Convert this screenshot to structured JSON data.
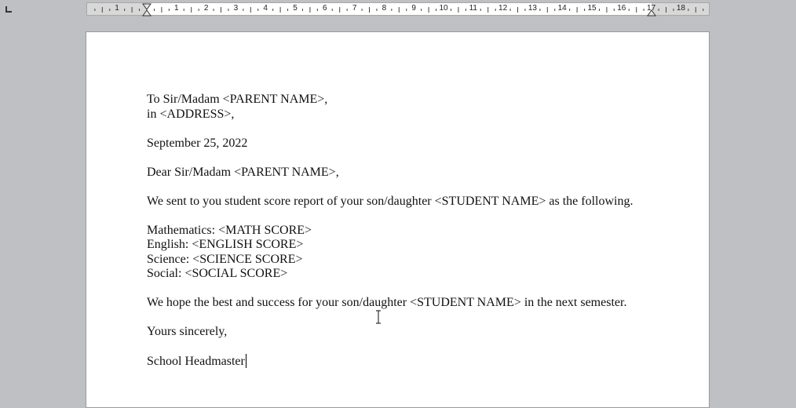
{
  "ruler": {
    "left_labels": [
      "1"
    ],
    "labels": [
      "1",
      "2",
      "3",
      "4",
      "5",
      "6",
      "7",
      "8",
      "9",
      "10",
      "11",
      "12",
      "13",
      "14",
      "15",
      "16",
      "17",
      "18"
    ]
  },
  "document": {
    "lines": {
      "to": "To Sir/Madam <PARENT NAME>,",
      "address": "in <ADDRESS>,",
      "date": "September 25, 2022",
      "greeting": "Dear Sir/Madam <PARENT NAME>,",
      "intro": "We sent to you student score report of your son/daughter <STUDENT NAME> as the following.",
      "math": "Mathematics: <MATH SCORE>",
      "english": "English: <ENGLISH SCORE>",
      "science": "Science: <SCIENCE SCORE>",
      "social": "Social: <SOCIAL SCORE>",
      "wish": "We hope the best and success for your son/daughter <STUDENT NAME> in the next semester.",
      "closing": "Yours sincerely,",
      "signature": "School Headmaster"
    }
  },
  "icons": {
    "tab_stop": "left-tab-stop-icon",
    "mouse_pointer": "ibeam-cursor-icon",
    "indent_left": "left-indent-marker-icon",
    "indent_right": "right-indent-marker-icon"
  }
}
